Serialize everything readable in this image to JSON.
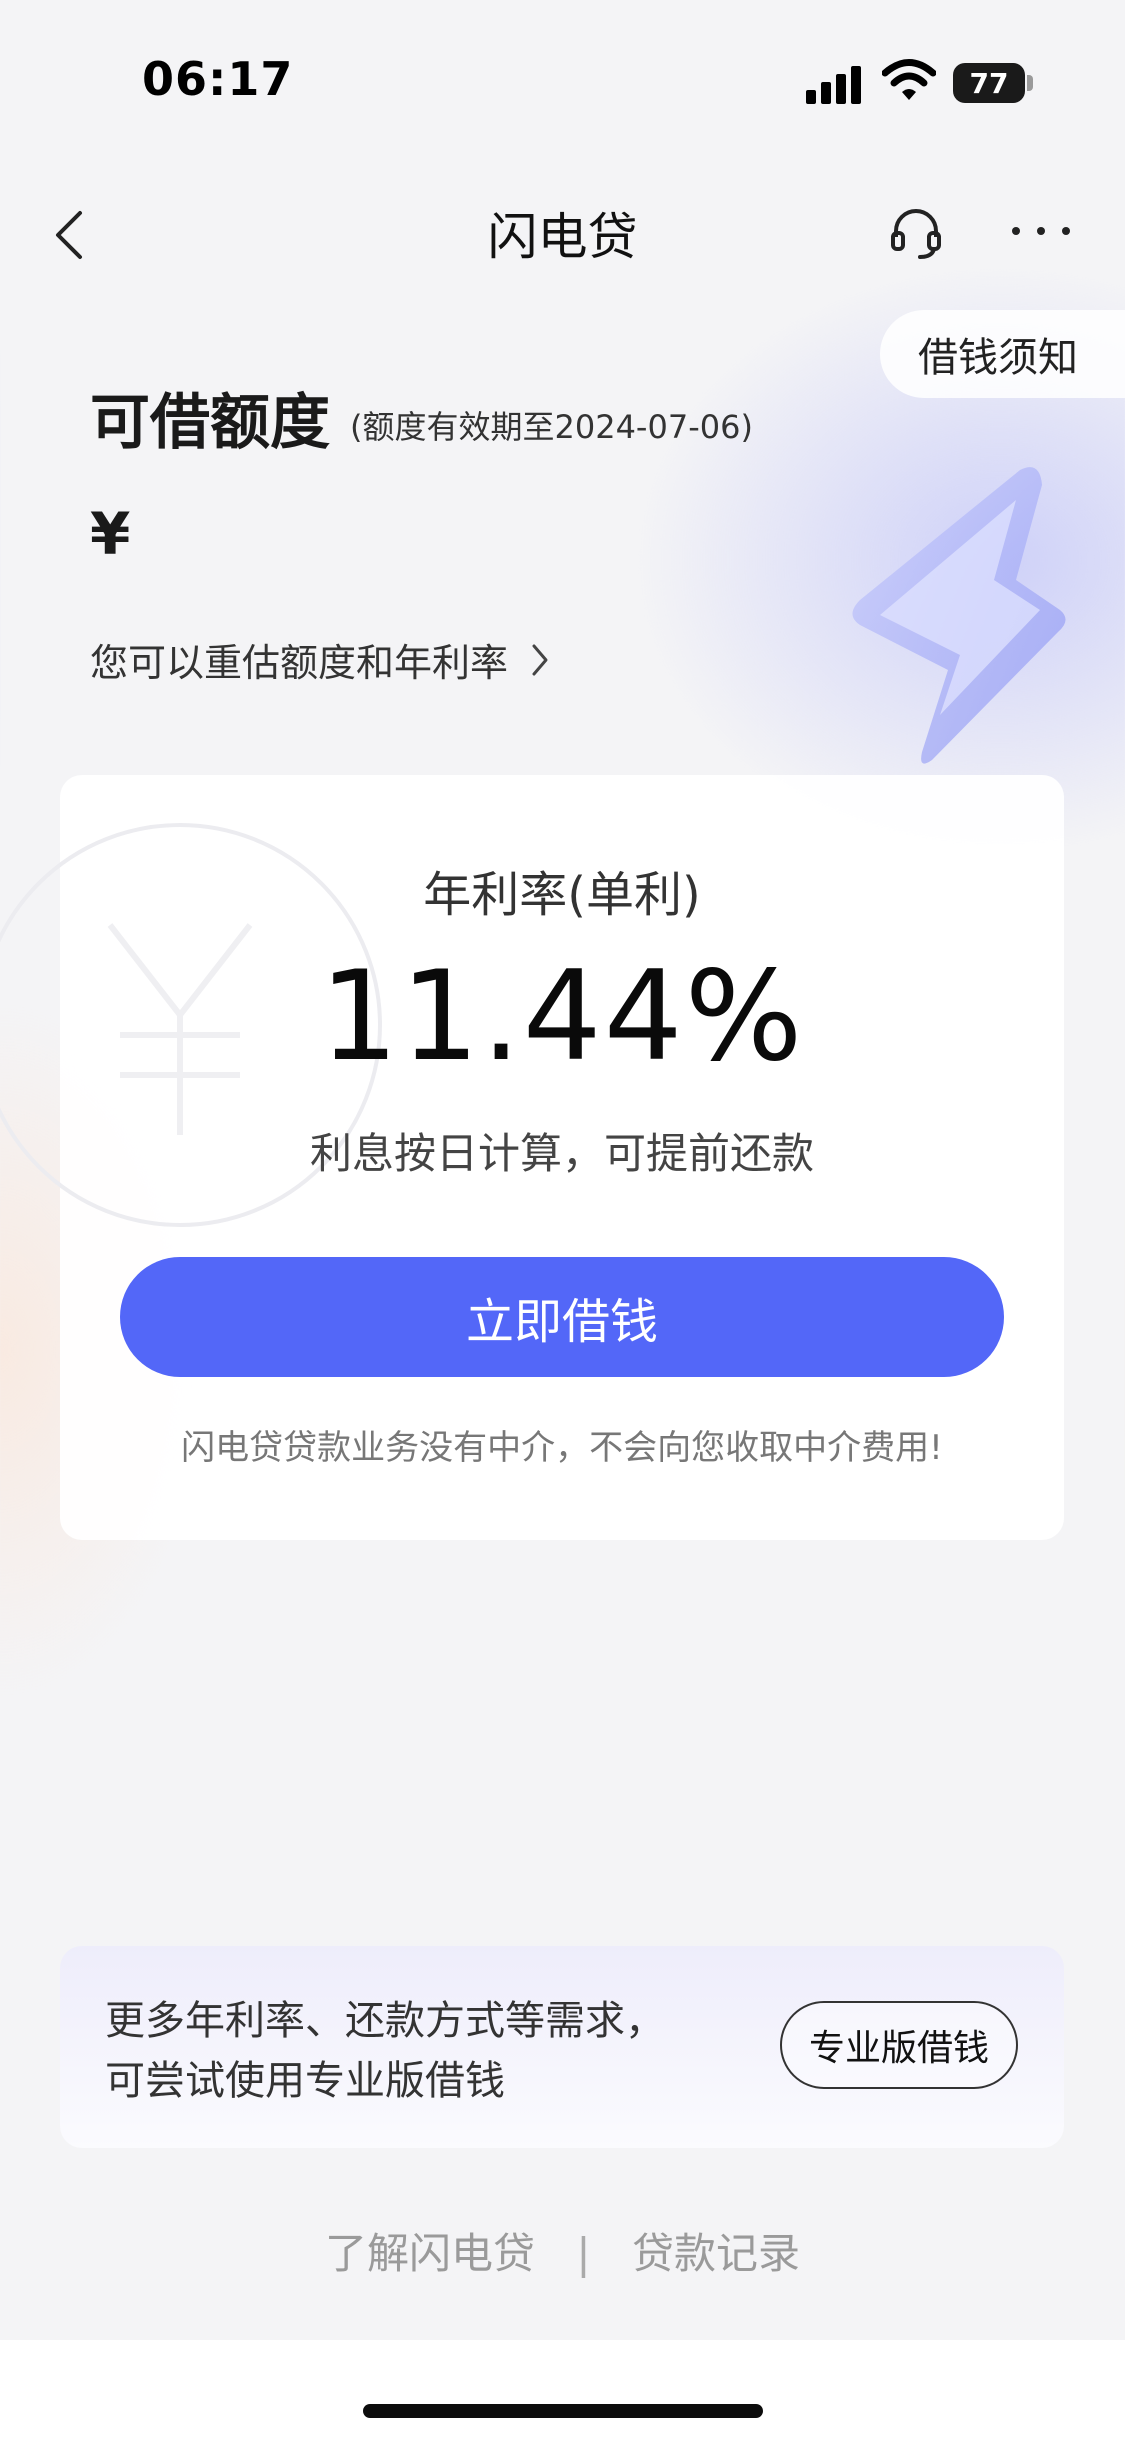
{
  "status_bar": {
    "time": "06:17",
    "battery": "77"
  },
  "nav": {
    "title": "闪电贷"
  },
  "notice_pill": "借钱须知",
  "credit": {
    "title": "可借额度",
    "validity": "(额度有效期至2024-07-06)",
    "currency_symbol": "¥",
    "reassess_link": "您可以重估额度和年利率"
  },
  "rate_card": {
    "label": "年利率(单利)",
    "value": "11.44%",
    "note": "利息按日计算，可提前还款",
    "borrow_button": "立即借钱",
    "disclaimer": "闪电贷贷款业务没有中介，不会向您收取中介费用!"
  },
  "promo": {
    "line1": "更多年利率、还款方式等需求，",
    "line2": "可尝试使用专业版借钱",
    "button": "专业版借钱"
  },
  "footer": {
    "about_link": "了解闪电贷",
    "separator": "|",
    "records_link": "贷款记录"
  },
  "colors": {
    "primary": "#5367f8",
    "background": "#f4f4f6"
  }
}
